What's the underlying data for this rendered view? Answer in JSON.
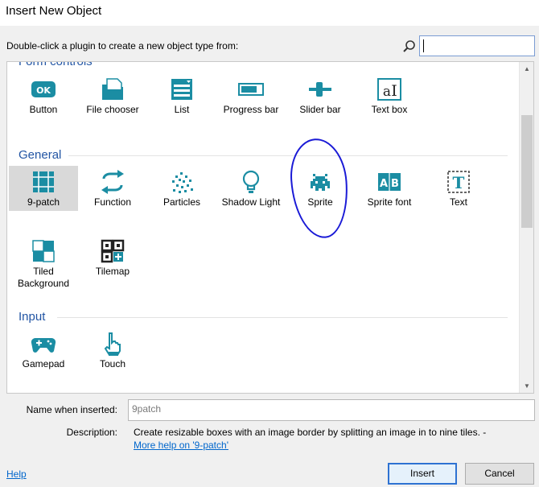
{
  "window": {
    "title": "Insert New Object"
  },
  "prompt": "Double-click a plugin to create a new object type from:",
  "search": {
    "value": ""
  },
  "colors": {
    "accent": "#2255a4",
    "icon_teal": "#1b8da3",
    "link": "#0066cc",
    "annotation": "#1a1ad6"
  },
  "categories": {
    "form_controls": {
      "title": "Form controls",
      "items": [
        {
          "label": "Button",
          "icon": "button-icon"
        },
        {
          "label": "File chooser",
          "icon": "file-chooser-icon"
        },
        {
          "label": "List",
          "icon": "list-icon"
        },
        {
          "label": "Progress bar",
          "icon": "progress-bar-icon"
        },
        {
          "label": "Slider bar",
          "icon": "slider-bar-icon"
        },
        {
          "label": "Text box",
          "icon": "text-box-icon"
        }
      ]
    },
    "general": {
      "title": "General",
      "items": [
        {
          "label": "9-patch",
          "icon": "nine-patch-icon",
          "selected": true
        },
        {
          "label": "Function",
          "icon": "function-icon"
        },
        {
          "label": "Particles",
          "icon": "particles-icon"
        },
        {
          "label": "Shadow Light",
          "icon": "shadow-light-icon"
        },
        {
          "label": "Sprite",
          "icon": "sprite-icon"
        },
        {
          "label": "Sprite font",
          "icon": "sprite-font-icon"
        },
        {
          "label": "Text",
          "icon": "text-icon"
        },
        {
          "label": "Tiled Background",
          "icon": "tiled-background-icon"
        },
        {
          "label": "Tilemap",
          "icon": "tilemap-icon"
        }
      ]
    },
    "input": {
      "title": "Input",
      "items": [
        {
          "label": "Gamepad",
          "icon": "gamepad-icon"
        },
        {
          "label": "Touch",
          "icon": "touch-icon"
        }
      ]
    }
  },
  "details": {
    "name_label": "Name when inserted:",
    "name_value": "9patch",
    "description_label": "Description:",
    "description": "Create resizable boxes with an image border by splitting an image in to nine tiles. -",
    "more_help": "More help on '9-patch'"
  },
  "footer": {
    "help": "Help",
    "insert": "Insert",
    "cancel": "Cancel"
  }
}
